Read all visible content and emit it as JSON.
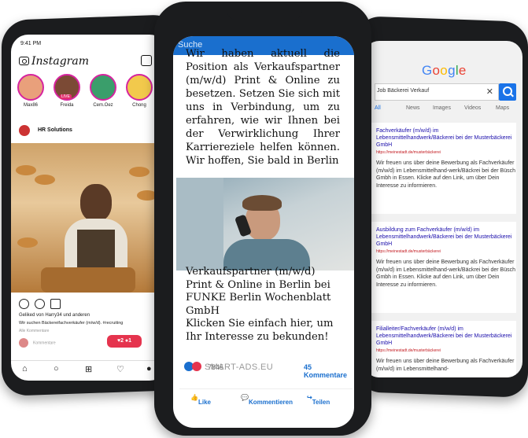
{
  "instagram": {
    "status_time": "9:41 PM",
    "app_name": "Instagram",
    "stories": [
      {
        "name": "Max86"
      },
      {
        "name": "Freida",
        "live": "LIVE"
      },
      {
        "name": "Cem.Oez"
      },
      {
        "name": "Chong"
      }
    ],
    "post_author": "HR Solutions",
    "liked_by": "Geliked von Harry34 und anderen",
    "caption": "Wir suchen Bäckereifachverkäufer (m/w/d). #recruiting",
    "all_comments": "Alle Kommentare",
    "comment_placeholder": "Kommentare",
    "notification": "♥2 ●1"
  },
  "center": {
    "search_placeholder": "Suche",
    "ad_text_top": "Wir haben aktuell die Position als Verkaufspartner (m/w/d) Print & Online zu besetzen. Setzen Sie sich mit uns in Verbindung, um zu erfahren, wie wir Ihnen bei der Verwirklichung Ihrer Karriereziele helfen können. Wir hoffen, Sie bald in Berlin",
    "ad_text_bottom": "Verkaufspartner (m/w/d) Print & Online in Berlin bei FUNKE Berlin Wochenblatt GmbH",
    "ad_cta": "Klicken Sie einfach hier, um Ihr Interesse zu bekunden!",
    "reaction_count": "7845",
    "watermark": "SMART-ADS.EU",
    "comments_count": "45 Kommentare",
    "actions": {
      "like": "Like",
      "comment": "Kommentieren",
      "share": "Teilen"
    }
  },
  "google": {
    "logo_letters": [
      "G",
      "o",
      "o",
      "g",
      "l",
      "e"
    ],
    "logo_colors": [
      "#4285F4",
      "#EA4335",
      "#FBBC05",
      "#4285F4",
      "#34A853",
      "#EA4335"
    ],
    "query": "Job Bäckerei Verkauf",
    "clear": "✕",
    "tabs": [
      "All",
      "News",
      "Images",
      "Videos",
      "Maps"
    ],
    "results": [
      {
        "title": "Fachverkäufer (m/w/d) im Lebensmittelhandwerk/Bäckerei bei der Musterbäckerei GmbH",
        "url": "https://meinestadt.de/musterbäckerei",
        "desc": "Wir freuen uns über deine Bewerbung als Fachverkäufer (m/w/d) im Lebensmittelhand-werk/Bäckrei bei der Büsch Gmbh in Essen. Klicke auf den Link, um über Dein Interesse zu informieren."
      },
      {
        "title": "Ausbildung zum Fachverkäufer (m/w/d) im Lebensmittelhandwerk/Bäckerei bei der Musterbäckerei GmbH",
        "url": "https://meinestadt.de/musterbäckerei",
        "desc": "Wir freuen uns über deine Bewerbung als Fachverkäufer (m/w/d) im Lebensmittelhand-werk/Bäckrei bei der Büsch Gmbh in Essen. Klicke auf den Link, um über Dein Interesse zu informieren."
      },
      {
        "title": "Filialleiter/Fachverkäufer (m/w/d) im Lebensmittelhandwerk/Bäckerei bei der Musterbäckerei GmbH",
        "url": "https://meinestadt.de/musterbäckerei",
        "desc": "Wir freuen uns über deine Bewerbung als Fachverkäufer (m/w/d) im Lebensmittelhand-"
      }
    ]
  }
}
